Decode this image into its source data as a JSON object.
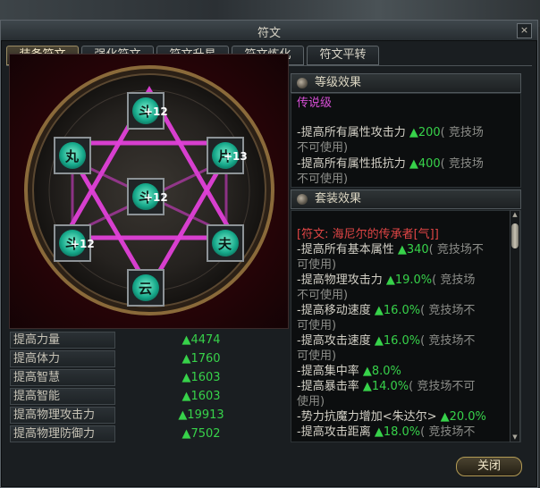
{
  "window": {
    "title": "符文",
    "close_glyph": "×"
  },
  "tabs": [
    {
      "label": "装备符文",
      "active": true
    },
    {
      "label": "强化符文",
      "active": false
    },
    {
      "label": "符文升星",
      "active": false
    },
    {
      "label": "符文炼化",
      "active": false
    },
    {
      "label": "符文平转",
      "active": false
    }
  ],
  "rune_slots": [
    {
      "glyph": "斗",
      "badge": "+12"
    },
    {
      "glyph": "丸",
      "badge": ""
    },
    {
      "glyph": "片",
      "badge": "+13"
    },
    {
      "glyph": "斗",
      "badge": "+12"
    },
    {
      "glyph": "斗",
      "badge": "+12"
    },
    {
      "glyph": "夫",
      "badge": ""
    },
    {
      "glyph": "云",
      "badge": ""
    }
  ],
  "stats": [
    {
      "label": "提高力量",
      "value": "▲4474"
    },
    {
      "label": "提高体力",
      "value": "▲1760"
    },
    {
      "label": "提高智慧",
      "value": "▲1603"
    },
    {
      "label": "提高智能",
      "value": "▲1603"
    },
    {
      "label": "提高物理攻击力",
      "value": "▲19913"
    },
    {
      "label": "提高物理防御力",
      "value": "▲7502"
    }
  ],
  "level_effect": {
    "header": "等级效果",
    "grade": "传说级",
    "lines": [
      {
        "text": "-提高所有属性攻击力 ",
        "value": "▲200",
        "note": "( 竞技场"
      },
      {
        "text": "不可使用)",
        "value": "",
        "note": ""
      },
      {
        "text": "-提高所有属性抵抗力 ",
        "value": "▲400",
        "note": "( 竞技场"
      },
      {
        "text": "不可使用)",
        "value": "",
        "note": ""
      }
    ]
  },
  "set_effect": {
    "header": "套装效果",
    "set_name": "[符文: 海尼尔的传承者[气]]",
    "lines": [
      {
        "text": "-提高所有基本属性 ",
        "value": "▲340",
        "note": "( 竞技场不"
      },
      {
        "text": "可使用)",
        "value": "",
        "note": ""
      },
      {
        "text": "-提高物理攻击力 ",
        "value": "▲19.0%",
        "note": "( 竞技场"
      },
      {
        "text": "不可使用)",
        "value": "",
        "note": ""
      },
      {
        "text": "-提高移动速度 ",
        "value": "▲16.0%",
        "note": "( 竞技场不"
      },
      {
        "text": "可使用)",
        "value": "",
        "note": ""
      },
      {
        "text": "-提高攻击速度 ",
        "value": "▲16.0%",
        "note": "( 竞技场不"
      },
      {
        "text": "可使用)",
        "value": "",
        "note": ""
      },
      {
        "text": "-提高集中率 ",
        "value": "▲8.0%",
        "note": ""
      },
      {
        "text": "-提高暴击率 ",
        "value": "▲14.0%",
        "note": "( 竞技场不可"
      },
      {
        "text": "使用)",
        "value": "",
        "note": ""
      },
      {
        "text": "-势力抗魔力增加<朱达尔> ",
        "value": "▲20.0%",
        "note": ""
      },
      {
        "text": "-提高攻击距离 ",
        "value": "▲18.0%",
        "note": "( 竞技场不"
      }
    ]
  },
  "buttons": {
    "close": "关闭"
  },
  "colors": {
    "accent_green": "#37d24a",
    "purple": "#d74fd6",
    "red": "#e04545",
    "magenta_star": "#e040d8"
  }
}
